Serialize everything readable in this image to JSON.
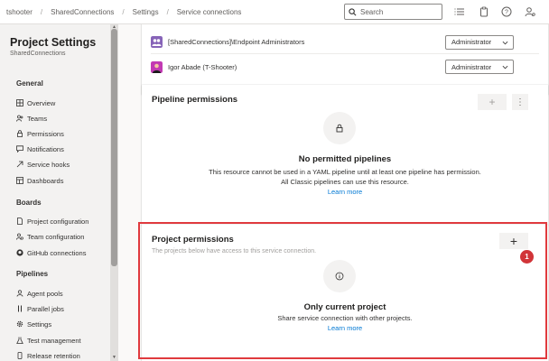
{
  "breadcrumb": [
    "tshooter",
    "SharedConnections",
    "Settings",
    "Service connections"
  ],
  "search": {
    "placeholder": "Search"
  },
  "top_icons": [
    "list-icon",
    "clipboard-icon",
    "help-icon",
    "user-settings-icon"
  ],
  "sidebar": {
    "title": "Project Settings",
    "subtitle": "SharedConnections",
    "sections": [
      {
        "label": "General",
        "items": [
          {
            "label": "Overview",
            "icon": "overview-icon"
          },
          {
            "label": "Teams",
            "icon": "teams-icon"
          },
          {
            "label": "Permissions",
            "icon": "lock-icon"
          },
          {
            "label": "Notifications",
            "icon": "chat-icon"
          },
          {
            "label": "Service hooks",
            "icon": "hook-icon"
          },
          {
            "label": "Dashboards",
            "icon": "dashboard-icon"
          }
        ]
      },
      {
        "label": "Boards",
        "items": [
          {
            "label": "Project configuration",
            "icon": "doc-icon"
          },
          {
            "label": "Team configuration",
            "icon": "team-config-icon"
          },
          {
            "label": "GitHub connections",
            "icon": "github-icon"
          }
        ]
      },
      {
        "label": "Pipelines",
        "items": [
          {
            "label": "Agent pools",
            "icon": "agent-pool-icon"
          },
          {
            "label": "Parallel jobs",
            "icon": "parallel-icon"
          },
          {
            "label": "Settings",
            "icon": "gear-icon"
          },
          {
            "label": "Test management",
            "icon": "test-icon"
          },
          {
            "label": "Release retention",
            "icon": "phone-icon"
          }
        ]
      }
    ]
  },
  "users": [
    {
      "name": "[SharedConnections]\\Endpoint Administrators",
      "role": "Administrator",
      "avatar_color": "#8764b8"
    },
    {
      "name": "Igor Abade (T-Shooter)",
      "role": "Administrator",
      "avatar_color": "#c239b3"
    }
  ],
  "pipeline_permissions": {
    "title": "Pipeline permissions",
    "add_label": "+",
    "more_label": "⋮",
    "empty_title": "No permitted pipelines",
    "line1": "This resource cannot be used in a YAML pipeline until at least one pipeline has permission.",
    "line2": "All Classic pipelines can use this resource.",
    "link": "Learn more"
  },
  "project_permissions": {
    "title": "Project permissions",
    "subtitle": "The projects below have access to this service connection.",
    "add_label": "+",
    "empty_title": "Only current project",
    "line1": "Share service connection with other projects.",
    "link": "Learn more"
  },
  "annotation": {
    "badge": "1",
    "color": "#e03a3e"
  },
  "colors": {
    "accent": "#0078d4",
    "highlight": "#e03a3e"
  }
}
